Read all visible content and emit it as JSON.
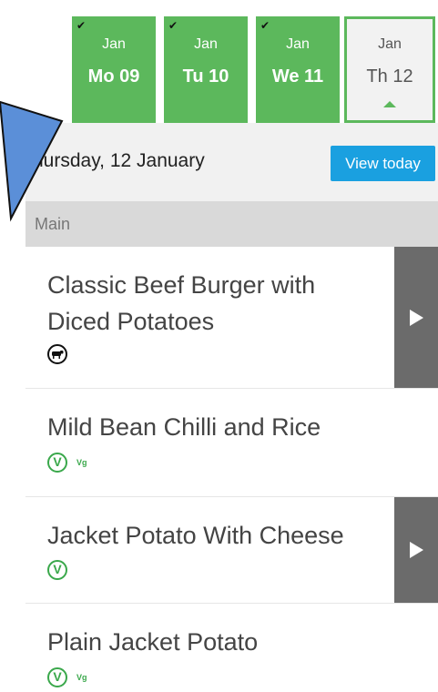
{
  "date_strip": {
    "days": [
      {
        "month": "Jan",
        "date": "Mo 09",
        "check": "✔"
      },
      {
        "month": "Jan",
        "date": "Tu 10",
        "check": "✔"
      },
      {
        "month": "Jan",
        "date": "We 11",
        "check": "✔"
      },
      {
        "month": "Jan",
        "date": "Th 12"
      }
    ]
  },
  "header": {
    "date_heading": "hursday, 12 January",
    "view_today_label": "View today"
  },
  "section": {
    "title": "Main"
  },
  "meals": [
    {
      "name": "Classic Beef Burger with Diced Potatoes",
      "icon": "cow-icon",
      "has_arrow": true
    },
    {
      "name": "Mild Bean Chilli and Rice",
      "icon": "vegetarian-icon",
      "tag": "Vg",
      "has_arrow": false
    },
    {
      "name": "Jacket Potato With Cheese",
      "icon": "vegetarian-icon",
      "has_arrow": true
    },
    {
      "name": "Plain Jacket Potato",
      "icon": "vegetarian-icon",
      "tag": "Vg",
      "has_arrow": false
    }
  ],
  "icons": {
    "vegetarian_glyph": "V"
  },
  "colors": {
    "green": "#5cb85c",
    "blue_button": "#1aa0e0",
    "arrow_panel": "#6b6b6b",
    "overlay_blue": "#5b8fd8"
  }
}
